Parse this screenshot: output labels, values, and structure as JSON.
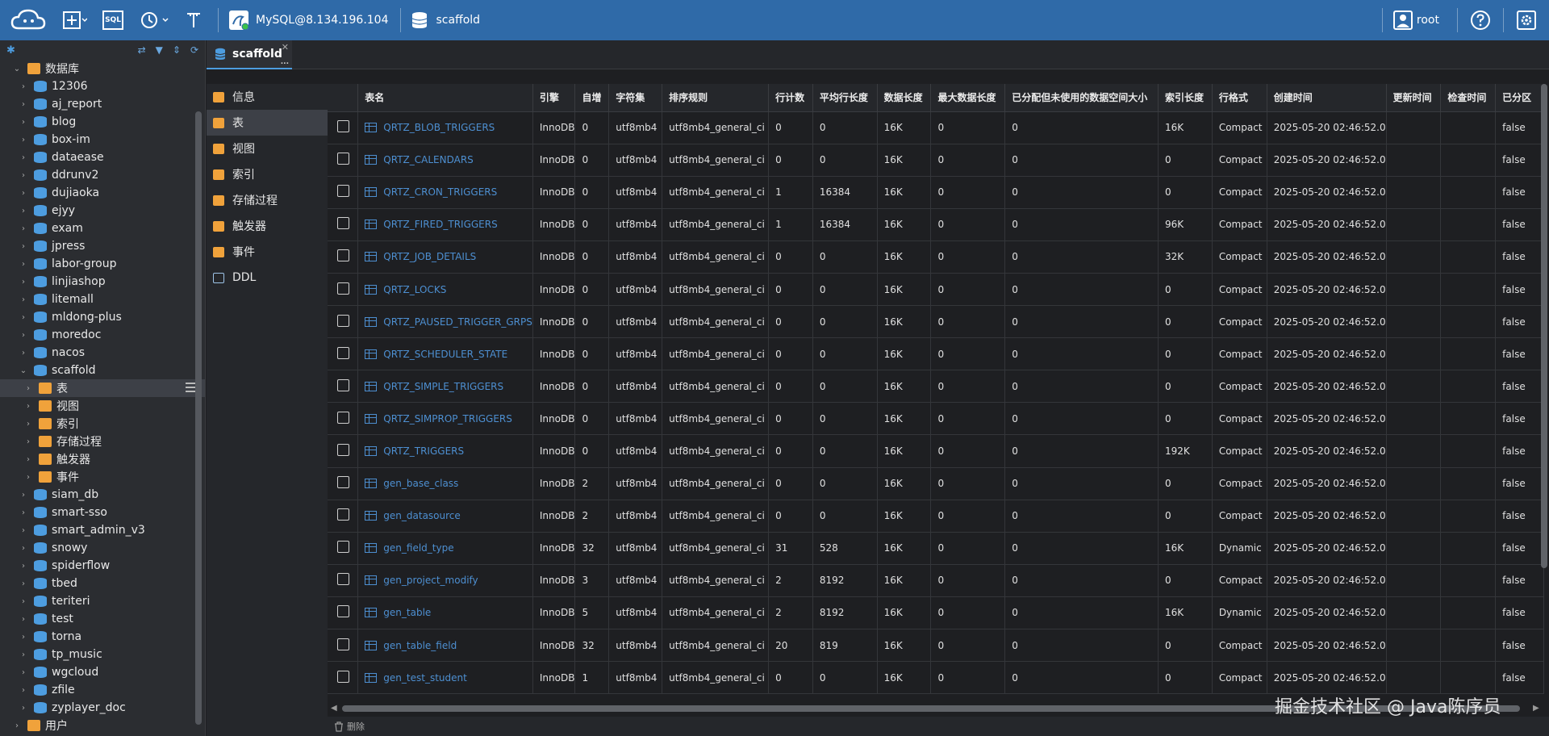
{
  "topbar": {
    "connection_label": "MySQL@8.134.196.104",
    "database_label": "scaffold",
    "user_label": "root",
    "sql_label": "SQL"
  },
  "sidebar": {
    "root_label": "数据库",
    "databases": [
      "12306",
      "aj_report",
      "blog",
      "box-im",
      "dataease",
      "ddrunv2",
      "dujiaoka",
      "ejyy",
      "exam",
      "jpress",
      "labor-group",
      "linjiashop",
      "litemall",
      "mldong-plus",
      "moredoc",
      "nacos",
      "scaffold"
    ],
    "scaffold_children": [
      "表",
      "视图",
      "索引",
      "存储过程",
      "触发器",
      "事件"
    ],
    "databases_after": [
      "siam_db",
      "smart-sso",
      "smart_admin_v3",
      "snowy",
      "spiderflow",
      "tbed",
      "teriteri",
      "test",
      "torna",
      "tp_music",
      "wgcloud",
      "zfile",
      "zyplayer_doc"
    ],
    "users_label": "用户"
  },
  "tab": {
    "label": "scaffold",
    "close": "✕",
    "more": "..."
  },
  "objnav": [
    "信息",
    "表",
    "视图",
    "索引",
    "存储过程",
    "触发器",
    "事件",
    "DDL"
  ],
  "table": {
    "headers": [
      "表名",
      "引擎",
      "自增",
      "字符集",
      "排序规则",
      "行计数",
      "平均行长度",
      "数据长度",
      "最大数据长度",
      "已分配但未使用的数据空间大小",
      "索引长度",
      "行格式",
      "创建时间",
      "更新时间",
      "检查时间",
      "已分区"
    ],
    "rows": [
      [
        "QRTZ_BLOB_TRIGGERS",
        "InnoDB",
        "0",
        "utf8mb4",
        "utf8mb4_general_ci",
        "0",
        "0",
        "16K",
        "0",
        "0",
        "16K",
        "Compact",
        "2025-05-20 02:46:52.0",
        "",
        "",
        "false"
      ],
      [
        "QRTZ_CALENDARS",
        "InnoDB",
        "0",
        "utf8mb4",
        "utf8mb4_general_ci",
        "0",
        "0",
        "16K",
        "0",
        "0",
        "0",
        "Compact",
        "2025-05-20 02:46:52.0",
        "",
        "",
        "false"
      ],
      [
        "QRTZ_CRON_TRIGGERS",
        "InnoDB",
        "0",
        "utf8mb4",
        "utf8mb4_general_ci",
        "1",
        "16384",
        "16K",
        "0",
        "0",
        "0",
        "Compact",
        "2025-05-20 02:46:52.0",
        "",
        "",
        "false"
      ],
      [
        "QRTZ_FIRED_TRIGGERS",
        "InnoDB",
        "0",
        "utf8mb4",
        "utf8mb4_general_ci",
        "1",
        "16384",
        "16K",
        "0",
        "0",
        "96K",
        "Compact",
        "2025-05-20 02:46:52.0",
        "",
        "",
        "false"
      ],
      [
        "QRTZ_JOB_DETAILS",
        "InnoDB",
        "0",
        "utf8mb4",
        "utf8mb4_general_ci",
        "0",
        "0",
        "16K",
        "0",
        "0",
        "32K",
        "Compact",
        "2025-05-20 02:46:52.0",
        "",
        "",
        "false"
      ],
      [
        "QRTZ_LOCKS",
        "InnoDB",
        "0",
        "utf8mb4",
        "utf8mb4_general_ci",
        "0",
        "0",
        "16K",
        "0",
        "0",
        "0",
        "Compact",
        "2025-05-20 02:46:52.0",
        "",
        "",
        "false"
      ],
      [
        "QRTZ_PAUSED_TRIGGER_GRPS",
        "InnoDB",
        "0",
        "utf8mb4",
        "utf8mb4_general_ci",
        "0",
        "0",
        "16K",
        "0",
        "0",
        "0",
        "Compact",
        "2025-05-20 02:46:52.0",
        "",
        "",
        "false"
      ],
      [
        "QRTZ_SCHEDULER_STATE",
        "InnoDB",
        "0",
        "utf8mb4",
        "utf8mb4_general_ci",
        "0",
        "0",
        "16K",
        "0",
        "0",
        "0",
        "Compact",
        "2025-05-20 02:46:52.0",
        "",
        "",
        "false"
      ],
      [
        "QRTZ_SIMPLE_TRIGGERS",
        "InnoDB",
        "0",
        "utf8mb4",
        "utf8mb4_general_ci",
        "0",
        "0",
        "16K",
        "0",
        "0",
        "0",
        "Compact",
        "2025-05-20 02:46:52.0",
        "",
        "",
        "false"
      ],
      [
        "QRTZ_SIMPROP_TRIGGERS",
        "InnoDB",
        "0",
        "utf8mb4",
        "utf8mb4_general_ci",
        "0",
        "0",
        "16K",
        "0",
        "0",
        "0",
        "Compact",
        "2025-05-20 02:46:52.0",
        "",
        "",
        "false"
      ],
      [
        "QRTZ_TRIGGERS",
        "InnoDB",
        "0",
        "utf8mb4",
        "utf8mb4_general_ci",
        "0",
        "0",
        "16K",
        "0",
        "0",
        "192K",
        "Compact",
        "2025-05-20 02:46:52.0",
        "",
        "",
        "false"
      ],
      [
        "gen_base_class",
        "InnoDB",
        "2",
        "utf8mb4",
        "utf8mb4_general_ci",
        "0",
        "0",
        "16K",
        "0",
        "0",
        "0",
        "Compact",
        "2025-05-20 02:46:52.0",
        "",
        "",
        "false"
      ],
      [
        "gen_datasource",
        "InnoDB",
        "2",
        "utf8mb4",
        "utf8mb4_general_ci",
        "0",
        "0",
        "16K",
        "0",
        "0",
        "0",
        "Compact",
        "2025-05-20 02:46:52.0",
        "",
        "",
        "false"
      ],
      [
        "gen_field_type",
        "InnoDB",
        "32",
        "utf8mb4",
        "utf8mb4_general_ci",
        "31",
        "528",
        "16K",
        "0",
        "0",
        "16K",
        "Dynamic",
        "2025-05-20 02:46:52.0",
        "",
        "",
        "false"
      ],
      [
        "gen_project_modify",
        "InnoDB",
        "3",
        "utf8mb4",
        "utf8mb4_general_ci",
        "2",
        "8192",
        "16K",
        "0",
        "0",
        "0",
        "Compact",
        "2025-05-20 02:46:52.0",
        "",
        "",
        "false"
      ],
      [
        "gen_table",
        "InnoDB",
        "5",
        "utf8mb4",
        "utf8mb4_general_ci",
        "2",
        "8192",
        "16K",
        "0",
        "0",
        "16K",
        "Dynamic",
        "2025-05-20 02:46:52.0",
        "",
        "",
        "false"
      ],
      [
        "gen_table_field",
        "InnoDB",
        "32",
        "utf8mb4",
        "utf8mb4_general_ci",
        "20",
        "819",
        "16K",
        "0",
        "0",
        "0",
        "Compact",
        "2025-05-20 02:46:52.0",
        "",
        "",
        "false"
      ],
      [
        "gen_test_student",
        "InnoDB",
        "1",
        "utf8mb4",
        "utf8mb4_general_ci",
        "0",
        "0",
        "16K",
        "0",
        "0",
        "0",
        "Compact",
        "2025-05-20 02:46:52.0",
        "",
        "",
        "false"
      ]
    ]
  },
  "bottombar": {
    "delete_label": "删除"
  },
  "watermark": "掘金技术社区 @ Java陈序员",
  "colors": {
    "topbar": "#2f6aa8",
    "accent": "#4d9de0",
    "folder": "#f0a23b",
    "link": "#4d8fd1"
  }
}
